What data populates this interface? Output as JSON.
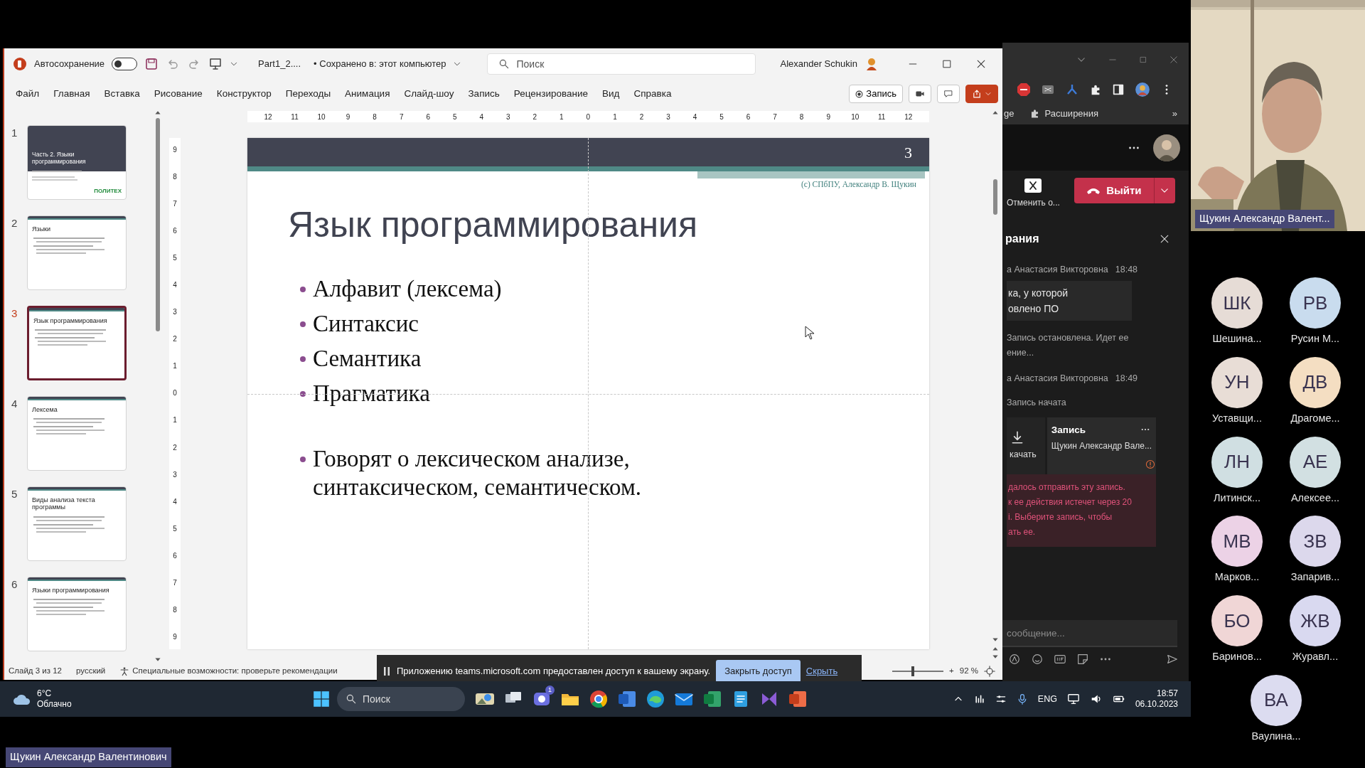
{
  "powerpoint": {
    "autosave_label": "Автосохранение",
    "autosave_on": false,
    "filename": "Part1_2....",
    "save_status": "• Сохранено в: этот компьютер",
    "search_placeholder": "Поиск",
    "user": "Alexander Schukin",
    "menu": [
      "Файл",
      "Главная",
      "Вставка",
      "Рисование",
      "Конструктор",
      "Переходы",
      "Анимация",
      "Слайд-шоу",
      "Запись",
      "Рецензирование",
      "Вид",
      "Справка"
    ],
    "record_button": "Запись",
    "ruler_h": [
      "12",
      "11",
      "10",
      "9",
      "8",
      "7",
      "6",
      "5",
      "4",
      "3",
      "2",
      "1",
      "0",
      "1",
      "2",
      "3",
      "4",
      "5",
      "6",
      "7",
      "8",
      "9",
      "10",
      "11",
      "12"
    ],
    "ruler_v": [
      "9",
      "8",
      "7",
      "6",
      "5",
      "4",
      "3",
      "2",
      "1",
      "0",
      "1",
      "2",
      "3",
      "4",
      "5",
      "6",
      "7",
      "8",
      "9"
    ],
    "thumbnails": [
      {
        "number": "1",
        "title": "Часть 2. Языки программирования",
        "kind": "title",
        "logo": "ПОЛИТЕХ",
        "selected": false
      },
      {
        "number": "2",
        "title": "Языки",
        "kind": "content",
        "selected": false
      },
      {
        "number": "3",
        "title": "Язык программирования",
        "kind": "content",
        "selected": true
      },
      {
        "number": "4",
        "title": "Лексема",
        "kind": "content",
        "selected": false
      },
      {
        "number": "5",
        "title": "Виды анализа текста программы",
        "kind": "content",
        "selected": false
      },
      {
        "number": "6",
        "title": "Языки программирования",
        "kind": "content",
        "selected": false
      }
    ],
    "slide": {
      "page_number": "3",
      "copyright": "(c) СПбПУ, Александр В. Щукин",
      "title": "Язык программирования",
      "bullets": [
        "Алфавит (лексема)",
        "Синтаксис",
        "Семантика",
        "Прагматика"
      ],
      "note_bullets": [
        "Говорят о лексическом анализе, синтаксическом, семантическом."
      ]
    },
    "status": {
      "slide_counter": "Слайд 3 из 12",
      "language": "русский",
      "accessibility": "Специальные возможности: проверьте рекомендации",
      "zoom_plus": "+",
      "zoom_value": "92 %",
      "zoom_slider": {
        "level": 0.4
      }
    }
  },
  "share_bar": {
    "message": "Приложению teams.microsoft.com предоставлен доступ к вашему экрану.",
    "stop_button": "Закрыть доступ",
    "hide_link": "Скрыть"
  },
  "browser": {
    "bookmark": "ge",
    "extensions": "Расширения",
    "more": "»"
  },
  "teams": {
    "cancel_label": "Отменить о...",
    "leave_button": "Выйти",
    "panel_title": "рания",
    "chat": [
      {
        "kind": "header",
        "sender": "а Анастасия Викторовна",
        "time": "18:48"
      },
      {
        "kind": "bubble",
        "lines": [
          "ка, у которой",
          "овлено ПО"
        ]
      },
      {
        "kind": "event",
        "lines": [
          "Запись остановлена. Идет ее",
          "ение..."
        ]
      },
      {
        "kind": "header",
        "sender": "а Анастасия Викторовна",
        "time": "18:49"
      },
      {
        "kind": "event",
        "lines": [
          "Запись начата"
        ]
      },
      {
        "kind": "recording",
        "download": "качать",
        "title": "Запись",
        "subtitle": "Щукин Александр Вале...",
        "error_lines": [
          "далось отправить эту запись.",
          "к ее действия истечет через 20",
          "і. Выберите запись, чтобы",
          "ать ее."
        ]
      }
    ],
    "compose_placeholder": "сообщение..."
  },
  "video": {
    "name": "Щукин Александр Валент..."
  },
  "participants": [
    {
      "initials": "ШК",
      "name": "Шешина...",
      "color": "#e6dcd6"
    },
    {
      "initials": "РВ",
      "name": "Русин М...",
      "color": "#c9dcee"
    },
    {
      "initials": "УН",
      "name": "Уставщи...",
      "color": "#e8ddd6"
    },
    {
      "initials": "ДВ",
      "name": "Драгоме...",
      "color": "#f4dec2"
    },
    {
      "initials": "ЛН",
      "name": "Литинск...",
      "color": "#d0dfe2"
    },
    {
      "initials": "АЕ",
      "name": "Алексее...",
      "color": "#d2e0e2"
    },
    {
      "initials": "МВ",
      "name": "Марков...",
      "color": "#ecd2e6"
    },
    {
      "initials": "ЗВ",
      "name": "Запарив...",
      "color": "#dcd8ec"
    },
    {
      "initials": "БО",
      "name": "Баринов...",
      "color": "#f0d6d6"
    },
    {
      "initials": "ЖВ",
      "name": "Журавл...",
      "color": "#d9d9f0"
    },
    {
      "initials": "ВА",
      "name": "Ваулина...",
      "color": "#dcdcf0"
    }
  ],
  "taskbar": {
    "temperature": "6°C",
    "weather": "Облачно",
    "search": "Поиск",
    "chat_badge": "1",
    "language": "ENG",
    "time": "18:57",
    "date": "06.10.2023"
  },
  "presenter_label": "Щукин Александр Валентинович"
}
